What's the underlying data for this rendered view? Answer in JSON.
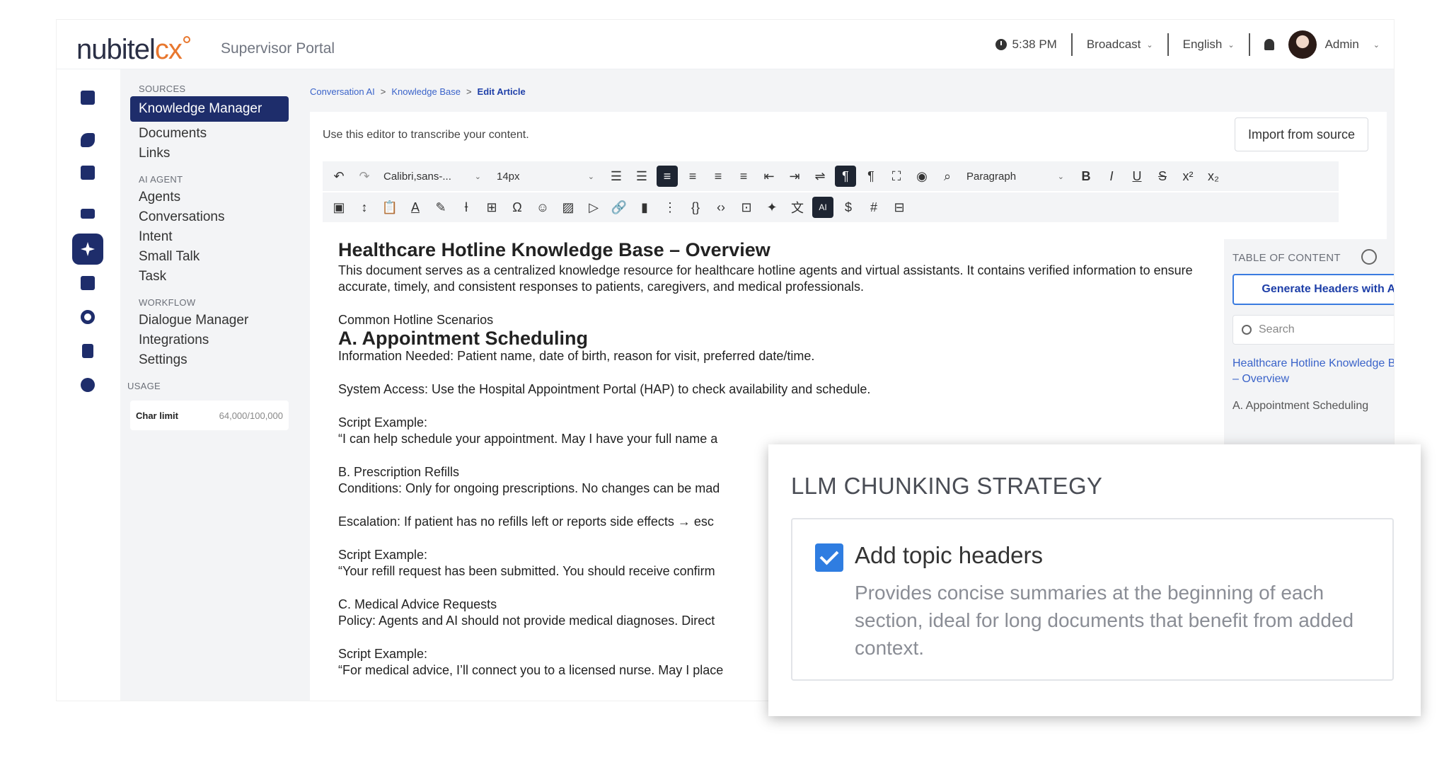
{
  "topbar": {
    "logo_main": "nubitel",
    "logo_cx": "cx",
    "portal": "Supervisor Portal",
    "time": "5:38 PM",
    "broadcast": "Broadcast",
    "language": "English",
    "user": "Admin"
  },
  "sidebar": {
    "sources_heading": "SOURCES",
    "sources": [
      "Knowledge Manager",
      "Documents",
      "Links"
    ],
    "ai_heading": "AI AGENT",
    "ai_items": [
      "Agents",
      "Conversations",
      "Intent",
      "Small Talk",
      "Task"
    ],
    "workflow_heading": "WORKFLOW",
    "workflow_items": [
      "Dialogue Manager",
      "Integrations",
      "Settings"
    ],
    "usage_heading": "USAGE",
    "usage_label": "Char limit",
    "usage_value": "64,000/100,000"
  },
  "breadcrumb": {
    "items": [
      "Conversation AI",
      "Knowledge Base",
      "Edit Article"
    ],
    "separator": ">"
  },
  "editor": {
    "hint": "Use this editor to transcribe your content.",
    "import_button": "Import from source",
    "font_family": "Calibri,sans-...",
    "font_size": "14px",
    "block_format": "Paragraph"
  },
  "document": {
    "title": "Healthcare Hotline Knowledge Base – Overview",
    "intro": "This document serves as a centralized knowledge resource for healthcare hotline agents and virtual assistants. It contains verified information to ensure accurate, timely, and consistent responses to patients, caregivers, and medical professionals.",
    "scenarios": "Common Hotline Scenarios",
    "sectionA": "A. Appointment Scheduling",
    "info_needed": "Information Needed: Patient name, date of birth, reason for visit, preferred date/time.",
    "system_access": "System Access: Use the Hospital Appointment Portal (HAP) to check availability and schedule.",
    "script_label": "Script Example:",
    "scriptA": "“I can help schedule your appointment. May I have your full name a",
    "sectionB": "B. Prescription Refills",
    "conditions": "Conditions: Only for ongoing prescriptions. No changes can be mad",
    "escalation": "Escalation: If patient has no refills left or reports side effects → esc",
    "scriptB": "“Your refill request has been submitted. You should receive confirm",
    "sectionC": "C. Medical Advice Requests",
    "policy": "Policy: Agents and AI should not provide medical diagnoses. Direct",
    "scriptC": "“For medical advice, I’ll connect you to a licensed nurse. May I place"
  },
  "toc": {
    "title": "TABLE OF CONTENT",
    "generate_button": "Generate Headers with AI",
    "search_placeholder": "Search",
    "link": "Healthcare Hotline Knowledge Base – Overview",
    "item": "A. Appointment Scheduling"
  },
  "popup": {
    "title": "LLM CHUNKING STRATEGY",
    "option_title": "Add topic headers",
    "option_checked": true,
    "option_desc": "Provides concise summaries at the beginning of each section, ideal for long documents that benefit from added context."
  }
}
